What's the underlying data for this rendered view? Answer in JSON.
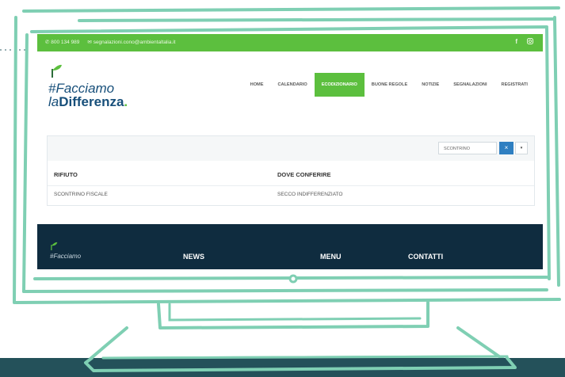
{
  "topbar": {
    "phone": "800 134 989",
    "email": "segnalazioni.cono@ambientaltalia.it",
    "social_facebook": "f",
    "icons": [
      "phone-icon",
      "mail-icon",
      "facebook-icon",
      "instagram-icon"
    ]
  },
  "logo": {
    "line1": "#Facciamo",
    "line2_prefix": "la",
    "line2_bold": "Differenza",
    "line2_dot": "."
  },
  "nav": {
    "items": [
      "HOME",
      "CALENDARIO",
      "ECODIZIONARIO",
      "BUONE REGOLE",
      "NOTIZIE",
      "SEGNALAZIONI",
      "REGISTRATI"
    ],
    "active_index": 2
  },
  "search": {
    "value": "SCONTRINO",
    "clear_label": "×",
    "dropdown_label": "▾"
  },
  "table": {
    "headers": [
      "RIFIUTO",
      "DOVE CONFERIRE"
    ],
    "rows": [
      [
        "SCONTRINO FISCALE",
        "SECCO INDIFFERENZIATO"
      ]
    ]
  },
  "footer": {
    "logo_text": "#Facciamo",
    "columns": [
      "NEWS",
      "MENU",
      "CONTATTI"
    ]
  },
  "colors": {
    "accent_green": "#5cbf3e",
    "frame_teal": "#7fcfb3",
    "footer_navy": "#0f2c3f",
    "logo_blue": "#174f7a",
    "button_blue": "#2f7fc1"
  }
}
